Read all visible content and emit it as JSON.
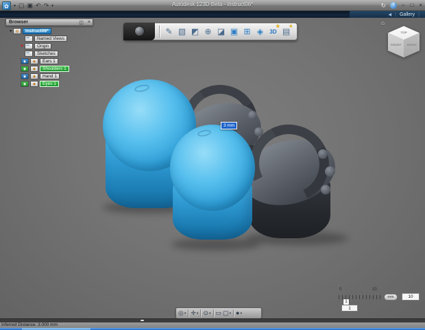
{
  "window": {
    "title": "Autodesk 123D Beta - instruct06*",
    "sync_icon": "↻",
    "help_icon": "?",
    "minimize": "–",
    "restore": "□",
    "close": "×"
  },
  "gallery_bar": {
    "back_icon": "◀",
    "divider": "|",
    "tab": "Gallery"
  },
  "quick_access": {
    "logo_icon": "✿",
    "dropdown_icon": "▾",
    "open_icon": "▢",
    "save_icon": "▣",
    "undo_icon": "↶",
    "redo_icon": "↷"
  },
  "browser": {
    "header": "Browser",
    "pin_icon": "◫",
    "close_icon": "×",
    "expand_icon": "▾",
    "hidden_icon": "×",
    "eye_icon": "◉",
    "part_icon": "◆",
    "root": {
      "label": "instruct06*"
    },
    "items": [
      {
        "label": "Named Views",
        "selected": false
      },
      {
        "label": "Origin",
        "selected": false
      },
      {
        "label": "Sketches",
        "selected": false
      },
      {
        "label": "Ears 1",
        "selected": false
      },
      {
        "label": "Shoulders 1",
        "selected": true
      },
      {
        "label": "Hand 1",
        "selected": false
      },
      {
        "label": "Eyes 1",
        "selected": true
      }
    ]
  },
  "toolbar": {
    "star_icon": "★",
    "tools": [
      {
        "name": "sketch",
        "glyph": "✎"
      },
      {
        "name": "primitives",
        "glyph": "▧"
      },
      {
        "name": "extrude",
        "glyph": "◩"
      },
      {
        "name": "move",
        "glyph": "⊕"
      },
      {
        "name": "modify",
        "glyph": "◪"
      },
      {
        "name": "combine",
        "glyph": "▣"
      },
      {
        "name": "pattern",
        "glyph": "⊞"
      },
      {
        "name": "group",
        "glyph": "◈"
      },
      {
        "name": "text-3d",
        "glyph": "3D"
      },
      {
        "name": "insert-image",
        "glyph": "▤"
      }
    ]
  },
  "viewcube": {
    "home_icon": "⌂",
    "top": "TOP",
    "front": "FRONT",
    "right": "RIGHT"
  },
  "viewport": {
    "tooltip": "3 mm",
    "chevron": "^",
    "body_blue": "#3FB2E6",
    "body_dark": "#3A3E45",
    "selection_green": "#2FA83C",
    "background": "#747474"
  },
  "navbar": {
    "caret_icon": "▾",
    "items": [
      {
        "name": "orbit",
        "glyph": "◎"
      },
      {
        "name": "pan",
        "glyph": "✛"
      },
      {
        "name": "zoom",
        "glyph": "⊙"
      },
      {
        "name": "look-at",
        "glyph": "▭"
      },
      {
        "name": "view-box",
        "glyph": "▢"
      },
      {
        "name": "display-style",
        "glyph": "●"
      }
    ]
  },
  "scale_control": {
    "min_label": "0",
    "max_label": "10",
    "marker_value": "1",
    "units": "mm",
    "major_value": "10",
    "snap_value": "1"
  },
  "status_bar": {
    "text": "Inferred Distance: 3.000 mm"
  }
}
